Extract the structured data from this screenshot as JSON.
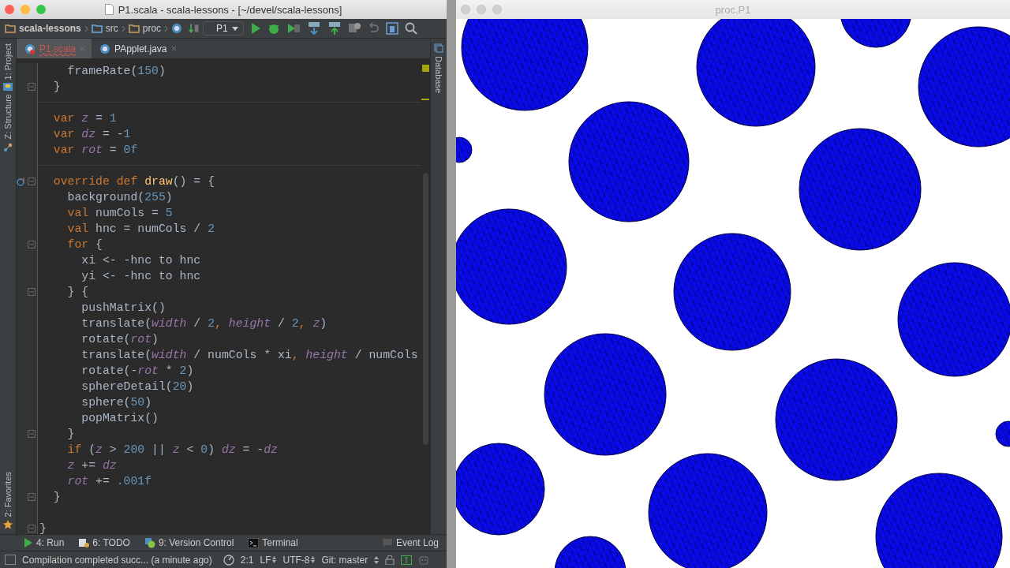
{
  "ide": {
    "title": "P1.scala - scala-lessons - [~/devel/scala-lessons]",
    "breadcrumbs": [
      "scala-lessons",
      "src",
      "proc"
    ],
    "run_config": "P1",
    "tabs": [
      {
        "label": "P1.scala",
        "selected": true,
        "error": true
      },
      {
        "label": "PApplet.java",
        "selected": false,
        "error": false
      }
    ],
    "left_tool_tabs": [
      "1: Project",
      "Z: Structure",
      "2: Favorites"
    ],
    "right_tool_tabs": [
      "Database"
    ],
    "code_lines": [
      {
        "tokens": [
          {
            "t": "    frameRate(",
            "kind": "plain"
          },
          {
            "t": "150",
            "kind": "num"
          },
          {
            "t": ")",
            "kind": "plain"
          }
        ]
      },
      {
        "tokens": [
          {
            "t": "  }",
            "kind": "plain"
          }
        ]
      },
      {
        "kind": "separated",
        "tokens": [
          {
            "t": "  var",
            "kind": "kw"
          },
          {
            "t": " z",
            "kind": "var"
          },
          {
            "t": " = ",
            "kind": "plain"
          },
          {
            "t": "1",
            "kind": "num"
          }
        ]
      },
      {
        "tokens": [
          {
            "t": "  var",
            "kind": "kw"
          },
          {
            "t": " dz",
            "kind": "var"
          },
          {
            "t": " = -",
            "kind": "plain"
          },
          {
            "t": "1",
            "kind": "num"
          }
        ]
      },
      {
        "tokens": [
          {
            "t": "  var",
            "kind": "kw"
          },
          {
            "t": " rot",
            "kind": "var"
          },
          {
            "t": " = ",
            "kind": "plain"
          },
          {
            "t": "0f",
            "kind": "num"
          }
        ]
      },
      {
        "kind": "method",
        "tokens": [
          {
            "t": "  override def",
            "kind": "kw"
          },
          {
            "t": " draw",
            "kind": "fn"
          },
          {
            "t": "() = {",
            "kind": "plain"
          }
        ]
      },
      {
        "tokens": [
          {
            "t": "    background(",
            "kind": "plain"
          },
          {
            "t": "255",
            "kind": "num"
          },
          {
            "t": ")",
            "kind": "plain"
          }
        ]
      },
      {
        "tokens": [
          {
            "t": "    val",
            "kind": "kw"
          },
          {
            "t": " numCols = ",
            "kind": "plain"
          },
          {
            "t": "5",
            "kind": "num"
          }
        ]
      },
      {
        "tokens": [
          {
            "t": "    val",
            "kind": "kw"
          },
          {
            "t": " hnc = numCols / ",
            "kind": "plain"
          },
          {
            "t": "2",
            "kind": "num"
          }
        ]
      },
      {
        "tokens": [
          {
            "t": "    for",
            "kind": "kw"
          },
          {
            "t": " {",
            "kind": "plain"
          }
        ]
      },
      {
        "tokens": [
          {
            "t": "      xi <- -hnc to hnc",
            "kind": "plain"
          }
        ]
      },
      {
        "tokens": [
          {
            "t": "      yi <- -hnc to hnc",
            "kind": "plain"
          }
        ]
      },
      {
        "tokens": [
          {
            "t": "    } {",
            "kind": "plain"
          }
        ]
      },
      {
        "tokens": [
          {
            "t": "      pushMatrix()",
            "kind": "plain"
          }
        ]
      },
      {
        "tokens": [
          {
            "t": "      translate(",
            "kind": "plain"
          },
          {
            "t": "width",
            "kind": "var"
          },
          {
            "t": " / ",
            "kind": "plain"
          },
          {
            "t": "2",
            "kind": "num"
          },
          {
            "t": ",",
            "kind": "kw"
          },
          {
            "t": " height",
            "kind": "var"
          },
          {
            "t": " / ",
            "kind": "plain"
          },
          {
            "t": "2",
            "kind": "num"
          },
          {
            "t": ",",
            "kind": "kw"
          },
          {
            "t": " z",
            "kind": "var"
          },
          {
            "t": ")",
            "kind": "plain"
          }
        ]
      },
      {
        "tokens": [
          {
            "t": "      rotate(",
            "kind": "plain"
          },
          {
            "t": "rot",
            "kind": "var"
          },
          {
            "t": ")",
            "kind": "plain"
          }
        ]
      },
      {
        "tokens": [
          {
            "t": "      translate(",
            "kind": "plain"
          },
          {
            "t": "width",
            "kind": "var"
          },
          {
            "t": " / numCols * xi",
            "kind": "plain"
          },
          {
            "t": ",",
            "kind": "kw"
          },
          {
            "t": " height",
            "kind": "var"
          },
          {
            "t": " / numCols",
            "kind": "plain"
          }
        ]
      },
      {
        "tokens": [
          {
            "t": "      rotate(-",
            "kind": "plain"
          },
          {
            "t": "rot",
            "kind": "var"
          },
          {
            "t": " * ",
            "kind": "plain"
          },
          {
            "t": "2",
            "kind": "num"
          },
          {
            "t": ")",
            "kind": "plain"
          }
        ]
      },
      {
        "tokens": [
          {
            "t": "      sphereDetail(",
            "kind": "plain"
          },
          {
            "t": "20",
            "kind": "num"
          },
          {
            "t": ")",
            "kind": "plain"
          }
        ]
      },
      {
        "tokens": [
          {
            "t": "      sphere(",
            "kind": "plain"
          },
          {
            "t": "50",
            "kind": "num"
          },
          {
            "t": ")",
            "kind": "plain"
          }
        ]
      },
      {
        "tokens": [
          {
            "t": "      popMatrix()",
            "kind": "plain"
          }
        ]
      },
      {
        "tokens": [
          {
            "t": "    }",
            "kind": "plain"
          }
        ]
      },
      {
        "tokens": [
          {
            "t": "    if",
            "kind": "kw"
          },
          {
            "t": " (",
            "kind": "plain"
          },
          {
            "t": "z",
            "kind": "var"
          },
          {
            "t": " > ",
            "kind": "plain"
          },
          {
            "t": "200",
            "kind": "num"
          },
          {
            "t": " || ",
            "kind": "plain"
          },
          {
            "t": "z",
            "kind": "var"
          },
          {
            "t": " < ",
            "kind": "plain"
          },
          {
            "t": "0",
            "kind": "num"
          },
          {
            "t": ") ",
            "kind": "plain"
          },
          {
            "t": "dz",
            "kind": "var"
          },
          {
            "t": " = -",
            "kind": "plain"
          },
          {
            "t": "dz",
            "kind": "var"
          }
        ]
      },
      {
        "tokens": [
          {
            "t": "    z",
            "kind": "var"
          },
          {
            "t": " += ",
            "kind": "plain"
          },
          {
            "t": "dz",
            "kind": "var"
          }
        ]
      },
      {
        "tokens": [
          {
            "t": "    rot",
            "kind": "var"
          },
          {
            "t": " += ",
            "kind": "plain"
          },
          {
            "t": ".001f",
            "kind": "num"
          }
        ]
      },
      {
        "tokens": [
          {
            "t": "  }",
            "kind": "plain"
          }
        ]
      },
      {
        "kind": "spaced",
        "tokens": [
          {
            "t": "}",
            "kind": "plain"
          }
        ]
      }
    ],
    "tool_windows": [
      "4: Run",
      "6: TODO",
      "9: Version Control",
      "Terminal"
    ],
    "event_log": "Event Log",
    "status_bar": {
      "message": "Compilation completed succ... (a minute ago)",
      "position": "2:1",
      "line_separator": "LF",
      "encoding": "UTF-8",
      "vcs": "Git: master"
    }
  },
  "sketch_window": {
    "title": "proc.P1"
  }
}
